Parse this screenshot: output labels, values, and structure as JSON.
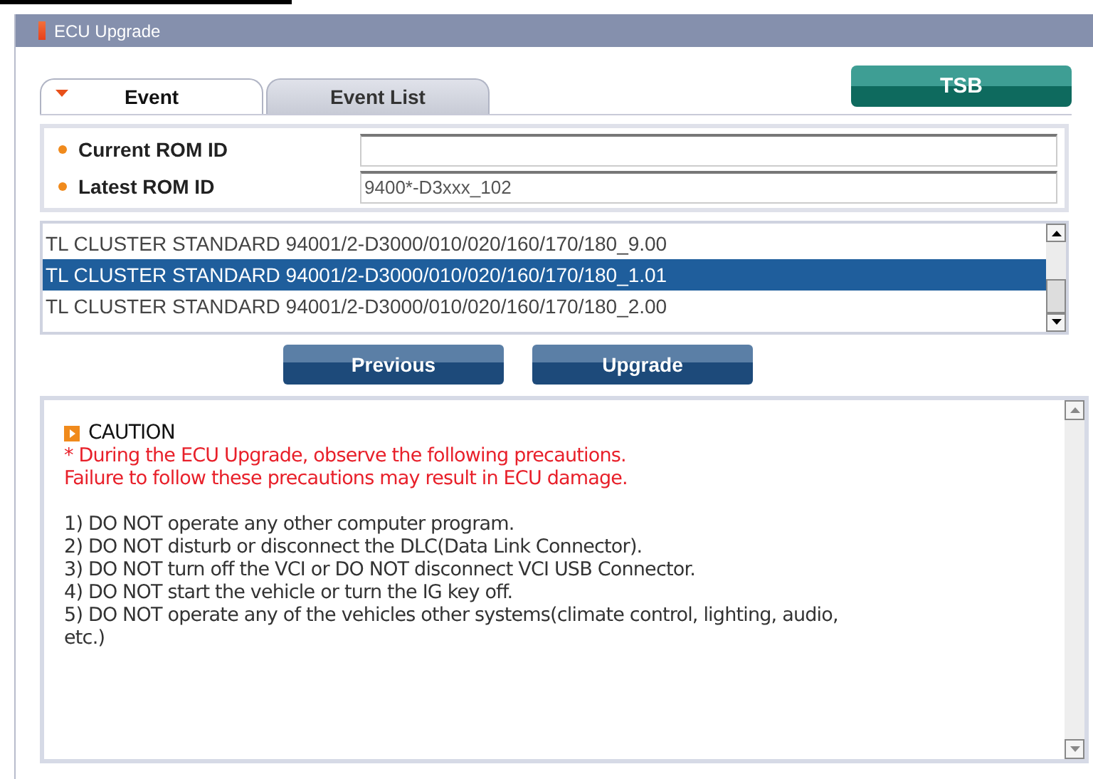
{
  "window": {
    "title": "ECU Upgrade"
  },
  "tabs": [
    {
      "label": "Event",
      "selected": true
    },
    {
      "label": "Event List",
      "selected": false
    }
  ],
  "tsb_button": "TSB",
  "fields": [
    {
      "label": "Current ROM ID"
    },
    {
      "label": "Latest ROM ID",
      "value": "9400*-D3xxx_102"
    }
  ],
  "list": {
    "items": [
      {
        "text": "TL CLUSTER STANDARD 94001/2-D3000/010/020/160/170/180_9.00",
        "selected": false
      },
      {
        "text": "TL CLUSTER STANDARD 94001/2-D3000/010/020/160/170/180_1.01",
        "selected": true
      },
      {
        "text": "TL CLUSTER STANDARD 94001/2-D3000/010/020/160/170/180_2.00",
        "selected": false
      }
    ]
  },
  "buttons": [
    "Previous",
    "Upgrade"
  ],
  "caution": {
    "title": "CAUTION",
    "warning": [
      "* During the ECU Upgrade, observe the following precautions.",
      "Failure to follow these precautions may result in ECU damage."
    ],
    "steps": [
      "1) DO NOT operate any other computer program.",
      "2) DO NOT disturb or disconnect the DLC(Data Link Connector).",
      "3) DO NOT turn off the VCI or DO NOT disconnect VCI USB Connector.",
      "4) DO NOT start the vehicle or turn the IG key off.",
      "5) DO NOT operate any of the vehicles other systems(climate control, lighting, audio, etc.)"
    ]
  }
}
